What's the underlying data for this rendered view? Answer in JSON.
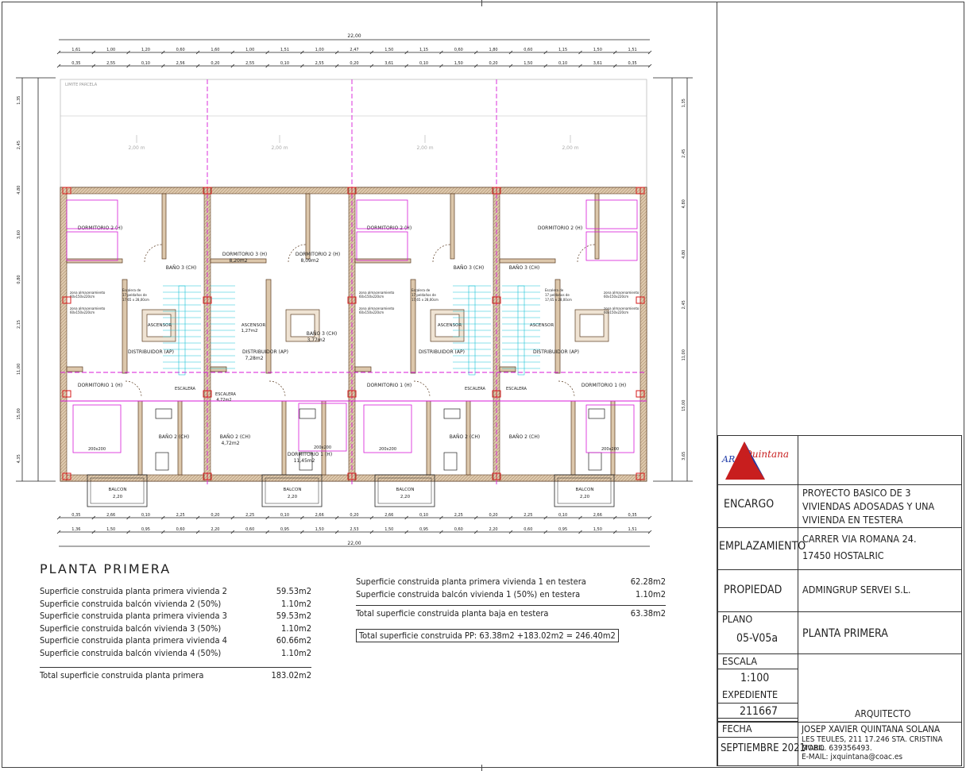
{
  "drawing": {
    "overall_width": "22,00",
    "top_dims_row1": [
      "1,61",
      "1,00",
      "1,20",
      "0,60",
      "1,60",
      "1,00",
      "1,51",
      "1,00",
      "2,47",
      "1,50",
      "1,15",
      "0,60",
      "1,80",
      "0,60",
      "1,15",
      "1,50",
      "1,51"
    ],
    "top_dims_row2": [
      "0,35",
      "2,55",
      "0,10",
      "2,56",
      "0,20",
      "2,55",
      "0,10",
      "2,55",
      "0,20",
      "3,61",
      "0,10",
      "1,50",
      "0,20",
      "1,50",
      "0,10",
      "3,61",
      "0,35"
    ],
    "bottom_dims_row1": [
      "0,35",
      "2,66",
      "0,10",
      "2,25",
      "0,20",
      "2,25",
      "0,10",
      "2,66",
      "0,20",
      "2,66",
      "0,10",
      "2,25",
      "0,20",
      "2,25",
      "0,10",
      "2,66",
      "0,35"
    ],
    "bottom_dims_row2": [
      "1,36",
      "1,50",
      "0,95",
      "0,60",
      "2,20",
      "0,60",
      "0,95",
      "1,50",
      "2,53",
      "1,50",
      "0,95",
      "0,60",
      "2,20",
      "0,60",
      "0,95",
      "1,50",
      "1,51"
    ],
    "left_dims": [
      "1,35",
      "2,45",
      "4,80",
      "3,60",
      "0,80",
      "2,15",
      "11,00",
      "15,00",
      "4,35"
    ],
    "right_dims": [
      "1,35",
      "2,45",
      "4,80",
      "4,80",
      "2,45",
      "11,00",
      "15,00",
      "3,65"
    ],
    "limit_label": "LIMITE PARCELA",
    "yard_labels": [
      "2,00 m",
      "2,00 m",
      "2,00 m",
      "2,00 m"
    ],
    "rooms": {
      "dormitorio2": "DORMITORIO 2 (H)",
      "dormitorio3": "DORMITORIO 3 (H)",
      "dormitorio3_area": "8,20m2",
      "dormitorio2b": "DORMITORIO 2 (H)",
      "dormitorio2b_area": "8,09m2",
      "bano3": "BAÑO 3 (CH)",
      "bano3b": "BAÑO 3 (CH)",
      "bano3b_area": "3,77m2",
      "distribuidor": "DISTRIBUIDOR (AP)",
      "distribuidor_area": "7,28m2",
      "ascensor": "ASCENSOR",
      "ascensor_area": "1,27m2",
      "dormitorio1": "DORMITORIO 1 (H)",
      "dormitorio1_area": "11,45m2",
      "bano2": "BAÑO 2 (CH)",
      "bano2_area": "4,72m2",
      "escalera": "ESCALERA",
      "escalera_area": "4,72m2",
      "balcon": "BALCON",
      "balcon_dim": "2,20",
      "zona": "zona almacenamiento",
      "zona_dim": "60x150x220cm",
      "escalera_note_1": "Escalera de",
      "escalera_note_2": "17 peldaños de",
      "escalera_note_3": "17,65 x 28,00cm",
      "bed": "200x200"
    }
  },
  "summary": {
    "title": "PLANTA PRIMERA",
    "rows": [
      {
        "label": "Superficie construida planta primera vivienda 2",
        "value": "59.53m2"
      },
      {
        "label": "Superficie construida balcón vivienda 2 (50%)",
        "value": "1.10m2"
      },
      {
        "label": "Superficie construida planta primera vivienda 3",
        "value": "59.53m2"
      },
      {
        "label": "Superficie construida balcón vivienda 3 (50%)",
        "value": "1.10m2"
      },
      {
        "label": "Superficie construida planta primera vivienda 4",
        "value": "60.66m2"
      },
      {
        "label": "Superficie construida balcón vivienda 4 (50%)",
        "value": "1.10m2"
      }
    ],
    "total_label": "Total superficie construida planta primera",
    "total_value": "183.02m2",
    "right_rows": [
      {
        "label": "Superficie construida planta primera vivienda 1 en testera",
        "value": "62.28m2"
      },
      {
        "label": "Superficie construida balcón vivienda 1 (50%) en testera",
        "value": "1.10m2"
      }
    ],
    "right_total_label": "Total superficie construida planta baja en testera",
    "right_total_value": "63.38m2",
    "grand_total": "Total superficie construida PP:  63.38m2 +183.02m2 =   246.40m2"
  },
  "title_block": {
    "logo_text_a": "AR",
    "logo_text_b": "Quintana",
    "encargo_label": "ENCARGO",
    "encargo_lines": [
      "PROYECTO BASICO DE 3",
      "VIVIENDAS ADOSADAS Y UNA",
      "VIVIENDA EN TESTERA"
    ],
    "emplazamiento_label": "EMPLAZAMIENTO",
    "emplazamiento_lines": [
      "CARRER VIA ROMANA 24.",
      "17450 HOSTALRIC"
    ],
    "propiedad_label": "PROPIEDAD",
    "propiedad_value": "ADMINGRUP SERVEI S.L.",
    "plano_label": "PLANO",
    "plano_value": "05-V05a",
    "plano_title": "PLANTA PRIMERA",
    "escala_label": "ESCALA",
    "escala_value": "1:100",
    "expediente_label": "EXPEDIENTE",
    "expediente_value": "211667",
    "fecha_label": "FECHA",
    "fecha_value": "SEPTIEMBRE 2021",
    "arquitecto_label": "ARQUITECTO",
    "arquitecto_name": "JOSEP XAVIER QUINTANA SOLANA",
    "arquitecto_address": "LES TEULES, 211 17.246 STA. CRISTINA D'ARO",
    "arquitecto_mobil": "MOBIL. 639356493.",
    "arquitecto_email": "E-MAIL: jxquintana@coac.es"
  },
  "colors": {
    "wall_fill": "#d8c3a8",
    "wall_stroke": "#5a3a20",
    "magenta": "#d81ad8",
    "cyan": "#19c4d8",
    "red": "#d61a1a",
    "line": "#222222",
    "logo_blue": "#1e3aa8",
    "logo_red": "#c81e1e"
  }
}
